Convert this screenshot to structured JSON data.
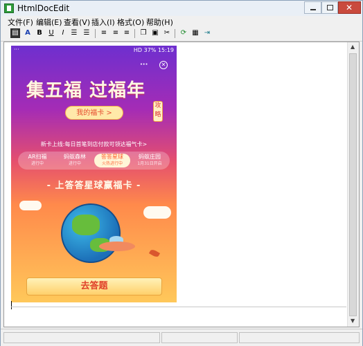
{
  "window": {
    "title": "HtmlDocEdit"
  },
  "menu": [
    "文件(F)",
    "编辑(E)",
    "查看(V)",
    "插入(I)",
    "格式(O)",
    "帮助(H)"
  ],
  "toolbar": [
    "save-doc-icon",
    "font-color-icon",
    "bold-icon",
    "underline-icon",
    "italic-icon",
    "numbered-list-icon",
    "bullet-list-icon",
    "align-left-icon",
    "align-center-icon",
    "align-right-icon",
    "copy-icon",
    "paste-icon",
    "cut-icon",
    "refresh-icon",
    "save-icon",
    "exit-icon"
  ],
  "phone": {
    "status": {
      "signal": "HD",
      "battery": "37%",
      "time": "15:19",
      "menu_dots": "···"
    },
    "more": "···",
    "close": "✕",
    "banner_title": "集五福 过福年",
    "my_card": "我的福卡 >",
    "guide": "攻略",
    "new_card_line": "新卡上线:每日首笔到店付款可领达福气卡>",
    "tabs": [
      {
        "name": "AR扫福",
        "status": "进行中"
      },
      {
        "name": "蚂蚁森林",
        "status": "进行中"
      },
      {
        "name": "答答星球",
        "status": "火热进行中"
      },
      {
        "name": "蚂蚁庄园",
        "status": "1月31日开启"
      }
    ],
    "quiz_heading": "- 上答答星球赢福卡 -",
    "answer_button": "去答题"
  }
}
